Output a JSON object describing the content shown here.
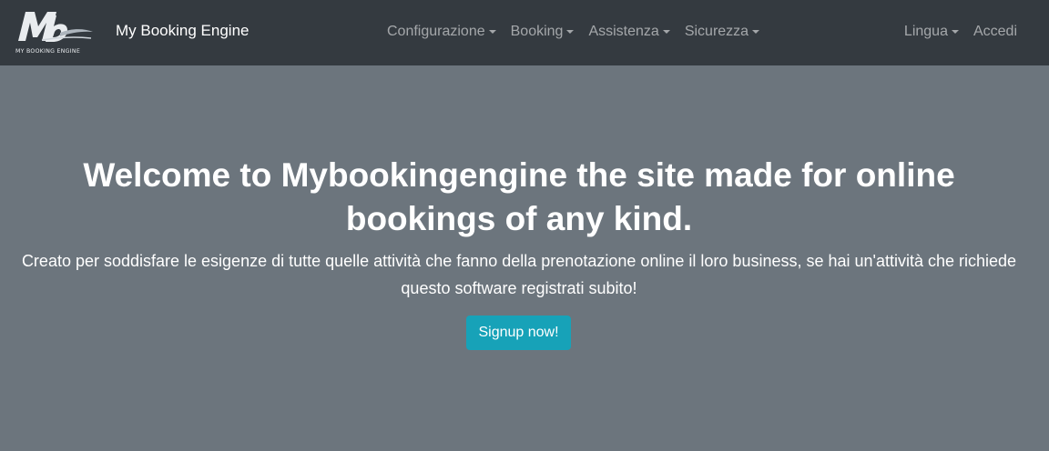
{
  "navbar": {
    "logo_text": "MY BOOKING ENGINE",
    "brand": "My Booking Engine",
    "menu": [
      {
        "label": "Configurazione"
      },
      {
        "label": "Booking"
      },
      {
        "label": "Assistenza"
      },
      {
        "label": "Sicurezza"
      }
    ],
    "language": "Lingua",
    "login": "Accedi"
  },
  "hero": {
    "title": "Welcome to Mybookingengine the site made for online bookings of any kind.",
    "subtitle": "Creato per soddisfare le esigenze di tutte quelle attività che fanno della prenotazione online il loro business, se hai un'attività che richiede questo software registrati subito!",
    "cta": "Signup now!"
  },
  "colors": {
    "navbar_bg": "#343a40",
    "hero_bg": "#6c757d",
    "button_bg": "#17a2b8"
  }
}
